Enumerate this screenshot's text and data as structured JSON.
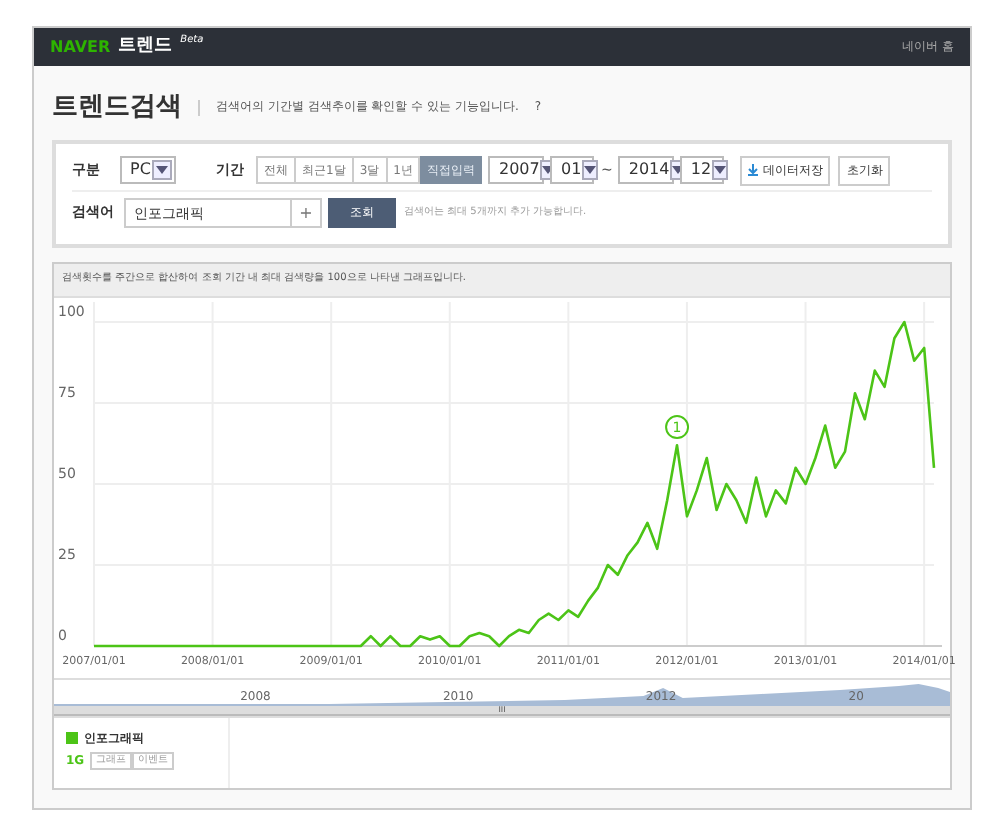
{
  "header": {
    "logo": "NAVER",
    "title": "트렌드",
    "badge": "Beta",
    "link": "네이버 홈"
  },
  "page": {
    "title": "트렌드검색",
    "description": "검색어의 기간별 검색추이를 확인할 수 있는 기능입니다.",
    "help": "?"
  },
  "filters": {
    "device_label": "구분",
    "device": "PC",
    "period_label": "기간",
    "periods": [
      {
        "label": "전체",
        "selected": false
      },
      {
        "label": "최근1달",
        "selected": false
      },
      {
        "label": "3달",
        "selected": false
      },
      {
        "label": "1년",
        "selected": false
      },
      {
        "label": "직접입력",
        "selected": true
      }
    ],
    "start_year": "2007",
    "start_month": "01",
    "range_sep": "~",
    "end_year": "2014",
    "end_month": "12",
    "save_button": "데이터저장",
    "reset_button": "초기화",
    "keyword_label": "검색어",
    "keyword": "인포그래픽",
    "add_button": "+",
    "search_button": "조회",
    "hint": "검색어는 최대 5개까지 추가 가능합니다."
  },
  "chart": {
    "note": "검색횟수를 주간으로 합산하여 조회 기간 내 최대 검색량을 100으로 나타낸 그래프입니다.",
    "chart_data": {
      "type": "line",
      "ylim": [
        0,
        100
      ],
      "yticks": [
        0,
        25,
        50,
        75,
        100
      ],
      "categories": [
        "2007/01/01",
        null,
        null,
        null,
        null,
        null,
        null,
        null,
        null,
        null,
        null,
        null,
        "2008/01/01",
        null,
        null,
        null,
        null,
        null,
        null,
        null,
        null,
        null,
        null,
        null,
        "2009/01/01",
        null,
        null,
        null,
        null,
        null,
        null,
        null,
        null,
        null,
        null,
        null,
        "2010/01/01",
        null,
        null,
        null,
        null,
        null,
        null,
        null,
        null,
        null,
        null,
        null,
        "2011/01/01",
        null,
        null,
        null,
        null,
        null,
        null,
        null,
        null,
        null,
        null,
        null,
        "2012/01/01",
        null,
        null,
        null,
        null,
        null,
        null,
        null,
        null,
        null,
        null,
        null,
        "2013/01/01",
        null,
        null,
        null,
        null,
        null,
        null,
        null,
        null,
        null,
        null,
        null,
        "2014/01/01",
        null
      ],
      "series": [
        {
          "name": "인포그래픽",
          "color": "#4cc417",
          "values": [
            0,
            0,
            0,
            0,
            0,
            0,
            0,
            0,
            0,
            0,
            0,
            0,
            0,
            0,
            0,
            0,
            0,
            0,
            0,
            0,
            0,
            0,
            0,
            0,
            0,
            0,
            0,
            0,
            3,
            0,
            3,
            0,
            0,
            3,
            2,
            3,
            0,
            0,
            3,
            4,
            3,
            0,
            3,
            5,
            4,
            8,
            10,
            8,
            11,
            9,
            14,
            18,
            25,
            22,
            28,
            32,
            38,
            30,
            45,
            62,
            40,
            48,
            58,
            42,
            50,
            45,
            38,
            52,
            40,
            48,
            44,
            55,
            50,
            58,
            68,
            55,
            60,
            78,
            70,
            85,
            80,
            95,
            100,
            88,
            92,
            55
          ]
        }
      ],
      "grid": true,
      "annotations": [
        {
          "y": 62,
          "text": "1"
        }
      ]
    },
    "navigator_labels": [
      "2008",
      "2010",
      "2012",
      "20"
    ],
    "scroll_grip": "III"
  },
  "legend": [
    {
      "code": "1G",
      "buttons": [
        "그래프",
        "이벤트"
      ]
    }
  ]
}
